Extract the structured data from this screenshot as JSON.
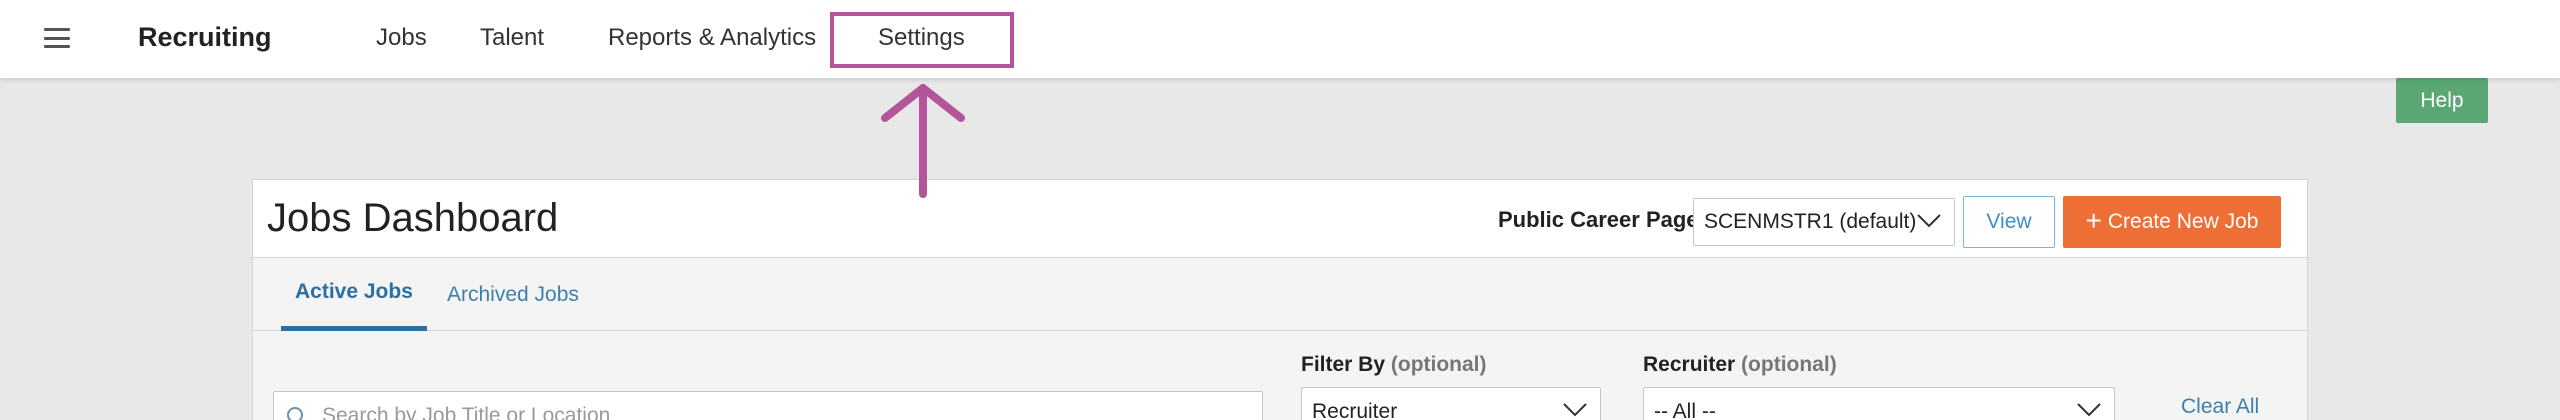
{
  "nav": {
    "brand": "Recruiting",
    "items": [
      {
        "label": "Jobs"
      },
      {
        "label": "Talent"
      },
      {
        "label": "Reports & Analytics"
      },
      {
        "label": "Settings"
      }
    ]
  },
  "help": {
    "label": "Help"
  },
  "dashboard": {
    "title": "Jobs Dashboard",
    "career_page_label": "Public Career Page",
    "career_page_value": "SCENMSTR1 (default)",
    "view_label": "View",
    "create_label": "Create New Job",
    "tabs": [
      {
        "label": "Active Jobs",
        "active": true
      },
      {
        "label": "Archived Jobs",
        "active": false
      }
    ],
    "search_placeholder": "Search by Job Title or Location",
    "filter_by": {
      "label": "Filter By",
      "optional": "(optional)",
      "value": "Recruiter"
    },
    "recruiter": {
      "label": "Recruiter",
      "optional": "(optional)",
      "value": "-- All --"
    },
    "clear_all": "Clear All"
  },
  "colors": {
    "accent_highlight": "#b4549b",
    "help_green": "#5aa774",
    "create_orange": "#ee6f35",
    "link_blue": "#3d7fb0"
  },
  "icons": [
    "hamburger-icon",
    "chevron-down-icon",
    "plus-icon",
    "search-icon",
    "arrow-up-icon"
  ]
}
